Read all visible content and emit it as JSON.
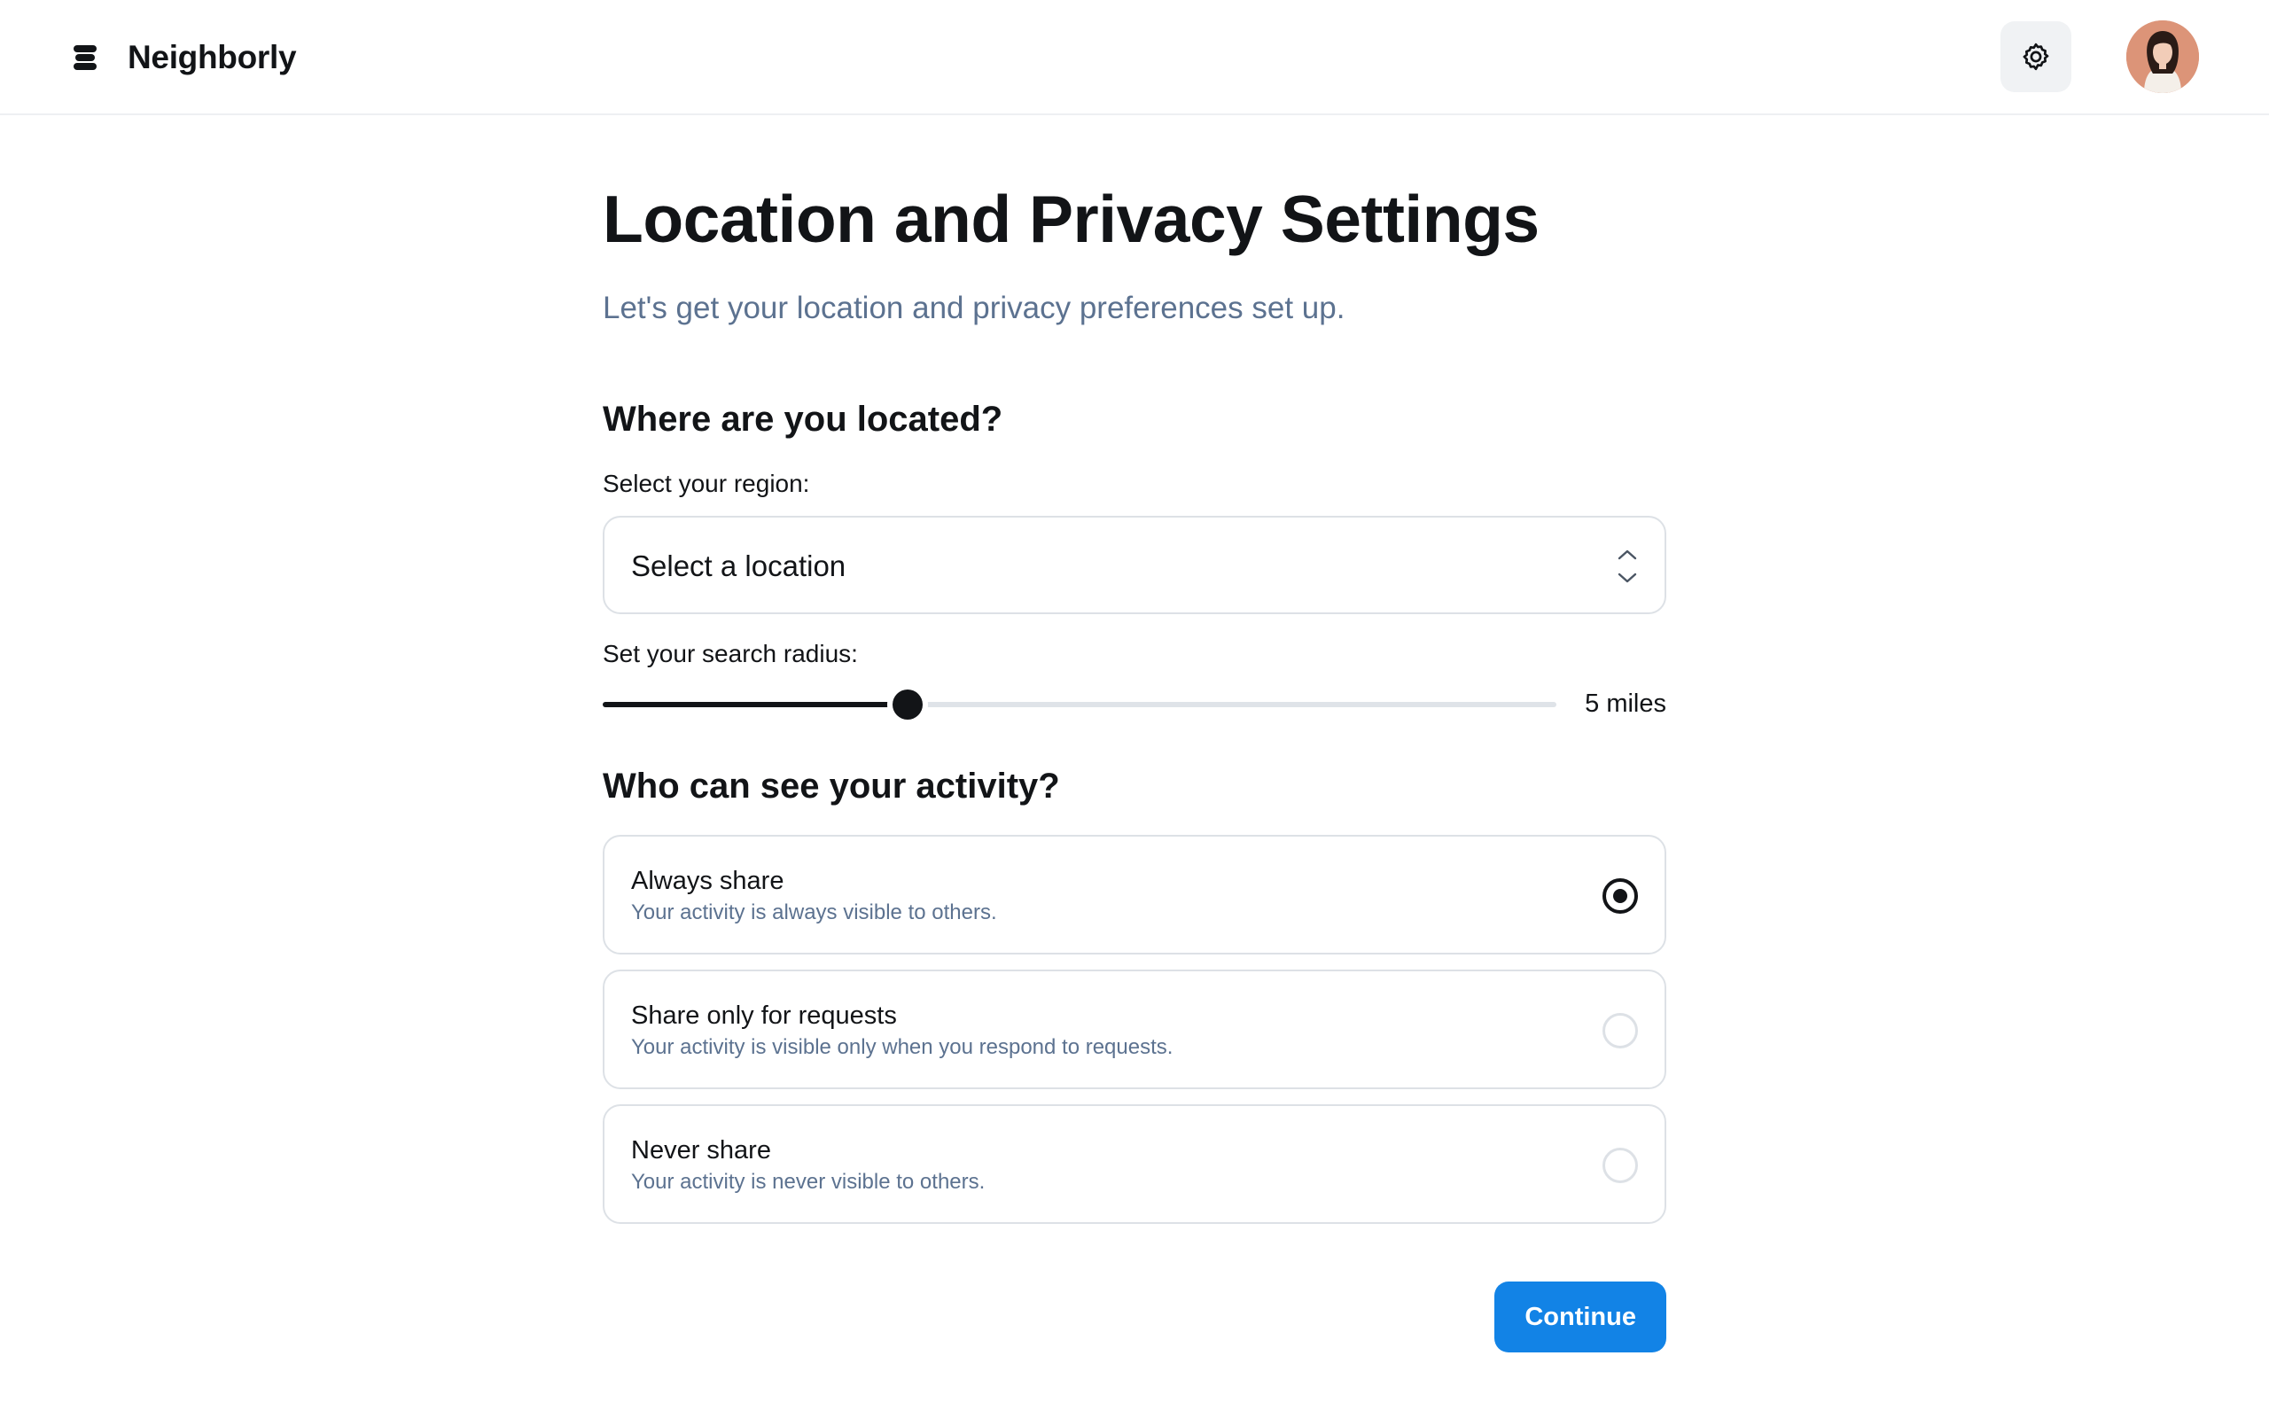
{
  "header": {
    "brand_name": "Neighborly",
    "brand_icon": "stack-layers-icon",
    "settings_icon": "gear-icon"
  },
  "main": {
    "title": "Location and Privacy Settings",
    "subtitle": "Let's get your location and privacy preferences set up.",
    "location_section": {
      "heading": "Where are you located?",
      "region_label": "Select your region:",
      "region_select_value": "Select a location",
      "radius_label": "Set your search radius:",
      "radius_value_text": "5 miles",
      "radius_fraction": 0.32
    },
    "activity_section": {
      "heading": "Who can see your activity?",
      "selected_option": "always",
      "options": [
        {
          "id": "always",
          "title": "Always share",
          "description": "Your activity is always visible to others."
        },
        {
          "id": "requests",
          "title": "Share only for requests",
          "description": "Your activity is visible only when you respond to requests."
        },
        {
          "id": "never",
          "title": "Never share",
          "description": "Your activity is never visible to others."
        }
      ]
    },
    "continue_label": "Continue"
  },
  "colors": {
    "accent": "#1283e6",
    "text_primary": "#121417",
    "text_secondary": "#5c7290",
    "border": "#dde1e6"
  }
}
